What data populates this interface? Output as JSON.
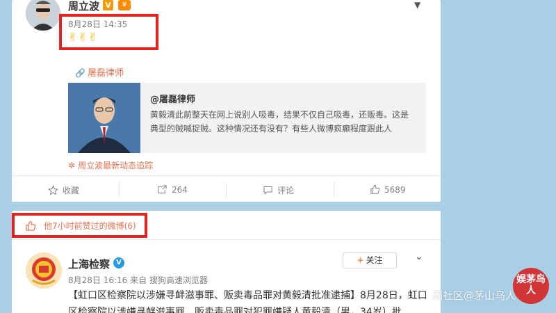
{
  "post1": {
    "username": "周立波",
    "verified_badge": "V",
    "vip_badge": "♛",
    "timestamp": "8月28日 14:35",
    "content_emojis": "✌✌✌",
    "repost_source_link": "屠磊律师",
    "quote": {
      "handle": "@屠磊律师",
      "text": "黄毅清此前整天在网上说别人吸毒，结果不仅自己吸毒，还贩毒。这是典型的贼喊捉贼。这种情况还有没有？有些人微博疯癫程度跟此人"
    },
    "track_link": "周立波最新动态追踪",
    "actions": {
      "favorite_label": "收藏",
      "repost_count": "264",
      "comment_label": "评论",
      "like_count": "5689"
    }
  },
  "liked_section": {
    "header": "他7小时前赞过的微博(6)"
  },
  "post2": {
    "username": "上海检察",
    "verified_badge": "V",
    "follow_label": "关注",
    "meta": "8月28日 16:16 来自 搜狗高速浏览器",
    "text": "【虹口区检察院以涉嫌寻衅滋事罪、贩卖毒品罪对黄毅清批准逮捕】8月28日，虹口区检察院以涉嫌寻衅滋事罪、贩卖毒品罪对犯罪嫌疑人黄毅清（男，34岁）批"
  },
  "watermark": {
    "text": "闻社区@茅山鸟人",
    "seal": "娱茅鸟人"
  },
  "colors": {
    "page_bg": "#a9cfe6",
    "accent_orange": "#eb7350",
    "highlight_red": "#e32222",
    "verified_blue": "#2a9be0"
  }
}
